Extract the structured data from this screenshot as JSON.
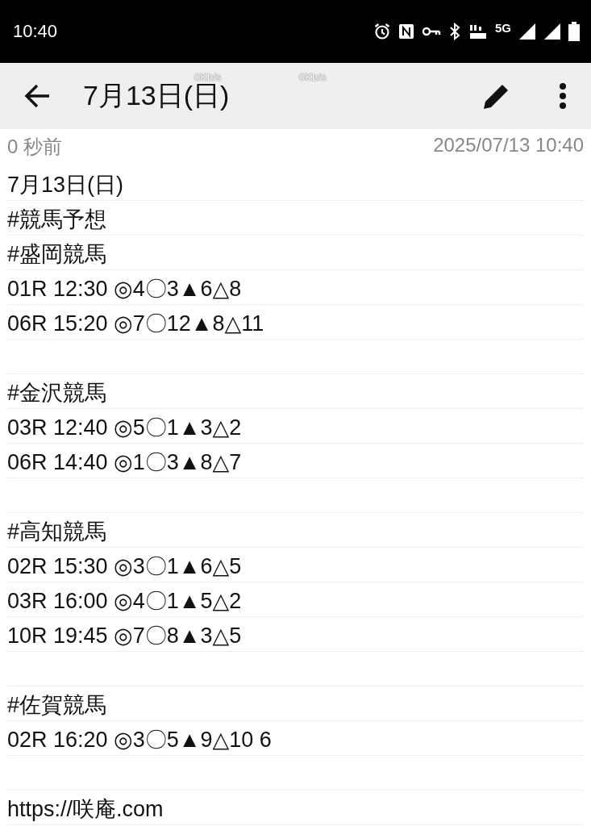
{
  "status_bar": {
    "time": "10:40",
    "network_label": "5G"
  },
  "net_speeds": [
    "0Kb/s",
    "0Kb/s"
  ],
  "app_bar": {
    "title": "7月13日(日)"
  },
  "meta": {
    "relative_time": "0 秒前",
    "timestamp": "2025/07/13 10:40"
  },
  "note_blocks": [
    {
      "lines": [
        "7月13日(日)",
        "#競馬予想",
        "#盛岡競馬",
        "01R 12:30 ◎4〇3▲6△8",
        "06R 15:20 ◎7〇12▲8△11"
      ]
    },
    {
      "lines": [
        "#金沢競馬",
        "03R 12:40 ◎5〇1▲3△2",
        "06R 14:40 ◎1〇3▲8△7"
      ]
    },
    {
      "lines": [
        "#高知競馬",
        "02R 15:30 ◎3〇1▲6△5",
        "03R 16:00 ◎4〇1▲5△2",
        "10R 19:45 ◎7〇8▲3△5"
      ]
    },
    {
      "lines": [
        "#佐賀競馬",
        "02R 16:20 ◎3〇5▲9△10 6"
      ]
    },
    {
      "lines": [
        "https://咲庵.com"
      ]
    }
  ]
}
